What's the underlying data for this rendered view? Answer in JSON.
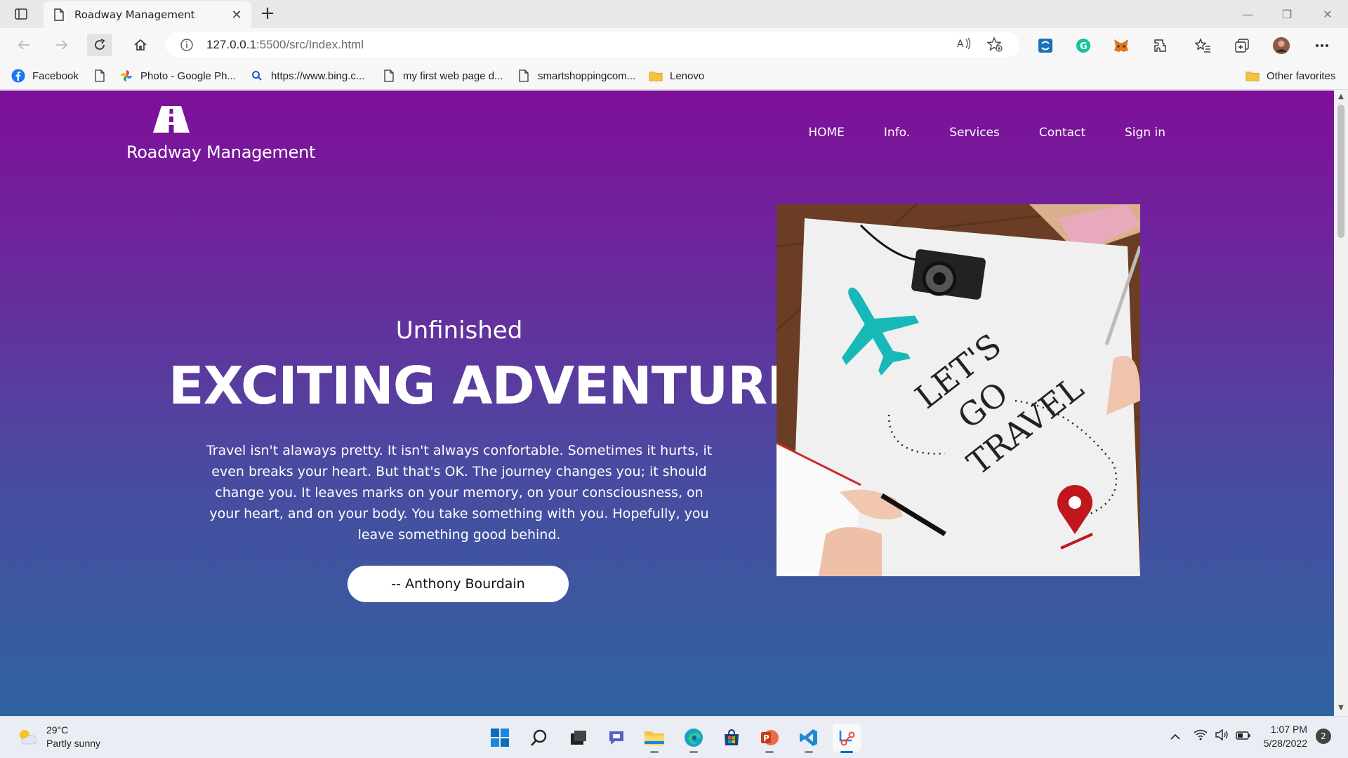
{
  "browser": {
    "tab_title": "Roadway Management",
    "url_host": "127.0.0.1",
    "url_path": ":5500/src/Index.html",
    "favorites": [
      {
        "label": "Facebook",
        "icon": "facebook-icon"
      },
      {
        "label": "",
        "icon": "page-icon"
      },
      {
        "label": "Photo - Google Ph...",
        "icon": "google-photos-icon"
      },
      {
        "label": "https://www.bing.c...",
        "icon": "search-icon"
      },
      {
        "label": "my first web page d...",
        "icon": "page-icon"
      },
      {
        "label": "smartshoppingcom...",
        "icon": "page-icon"
      },
      {
        "label": "Lenovo",
        "icon": "folder-icon"
      }
    ],
    "other_favorites": "Other favorites"
  },
  "site": {
    "logo_text": "Roadway Management",
    "nav": [
      "HOME",
      "Info.",
      "Services",
      "Contact",
      "Sign in"
    ],
    "hero_subtitle": "Unfinished",
    "hero_title": "EXCITING ADVENTURE",
    "hero_paragraph": "Travel isn't alaways pretty. It isn't always confortable. Sometimes it hurts, it even breaks your heart. But that's OK. The journey changes you; it should change you. It leaves marks on your memory, on your consciousness, on your heart, and on your body. You take something with you. Hopefully, you leave something good behind.",
    "quote_button": "-- Anthony Bourdain",
    "image_text": [
      "LET'S",
      "GO",
      "TRAVEL"
    ]
  },
  "taskbar": {
    "temperature": "29°C",
    "weather": "Partly sunny",
    "time": "1:07 PM",
    "date": "5/28/2022",
    "notifications": "2"
  },
  "colors": {
    "gradient_top": "#7e0f99",
    "gradient_bottom": "#2f63a0"
  }
}
